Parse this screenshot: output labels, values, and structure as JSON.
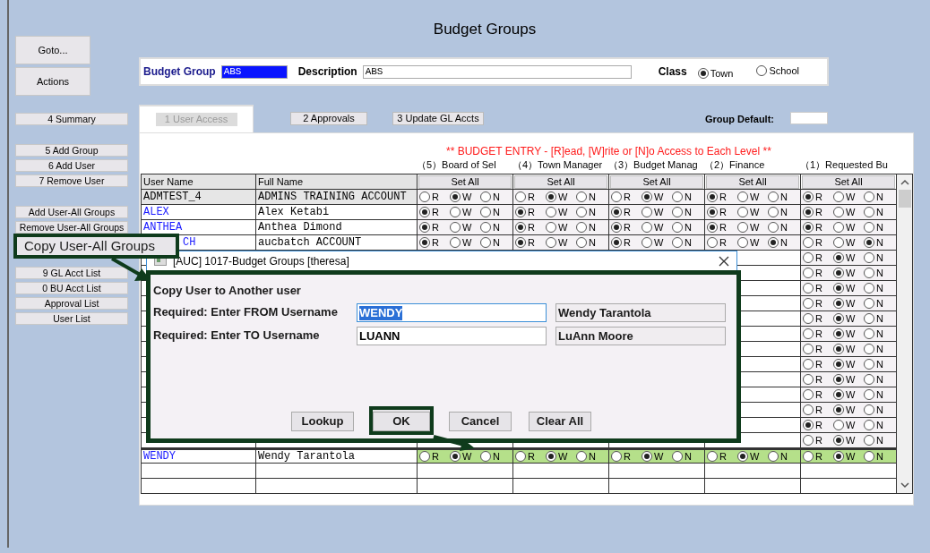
{
  "title": "Budget Groups",
  "sidebar": [
    [
      {
        "label": "Goto...",
        "kind": "large"
      },
      {
        "label": "Actions",
        "kind": "large"
      }
    ],
    [
      {
        "label": "4 Summary",
        "kind": "small"
      }
    ],
    [
      {
        "label": "5 Add Group",
        "kind": "small"
      },
      {
        "label": "6 Add User",
        "kind": "small"
      },
      {
        "label": "7 Remove User",
        "kind": "small"
      }
    ],
    [
      {
        "label": "Add User-All Groups",
        "kind": "small"
      },
      {
        "label": "Remove User-All Groups",
        "kind": "small"
      },
      {
        "kind": "covered"
      },
      {
        "kind": "covered"
      },
      {
        "label": "9 GL Acct List",
        "kind": "small"
      },
      {
        "label": "0 BU Acct List",
        "kind": "small"
      },
      {
        "label": "Approval List",
        "kind": "small"
      },
      {
        "label": "User List",
        "kind": "small"
      }
    ]
  ],
  "header": {
    "fields": [
      {
        "label": "Budget Group",
        "value": "ABS",
        "focused": true
      },
      {
        "label": "Description",
        "value": "ABS",
        "focused": false
      }
    ],
    "class": {
      "label": "Class",
      "options": [
        {
          "label": "Town",
          "selected": true
        },
        {
          "label": "School",
          "selected": false
        }
      ]
    }
  },
  "tabs": [
    {
      "label": "1 User Access",
      "selected": true
    },
    {
      "label": "2 Approvals",
      "selected": false
    },
    {
      "label": "3 Update GL Accts",
      "selected": false
    }
  ],
  "group_default": {
    "label": "Group Default:"
  },
  "table": {
    "notice": "** BUDGET ENTRY - [R]ead, [W]rite or [N]o Access to Each Level **",
    "level_columns": [
      {
        "heading": "（5）Board of Sel",
        "button": "Set All"
      },
      {
        "heading": "（4）Town Manager",
        "button": "Set All"
      },
      {
        "heading": "（3）Budget Manag",
        "button": "Set All"
      },
      {
        "heading": "（2）Finance",
        "button": "Set All"
      },
      {
        "heading": "（1）Requested Bu",
        "button": "Set All"
      }
    ],
    "columns": [
      "User Name",
      "Full Name"
    ],
    "rows": [
      {
        "user": "ADMTEST_4",
        "full_name": "ADMINS TRAINING ACCOUNT",
        "selected": true,
        "highlighted": false,
        "levels": [
          [
            {
              "label": "R",
              "selected": false
            },
            {
              "label": "W",
              "selected": true
            },
            {
              "label": "N",
              "selected": false
            }
          ],
          [
            {
              "label": "R",
              "selected": false
            },
            {
              "label": "W",
              "selected": true
            },
            {
              "label": "N",
              "selected": false
            }
          ],
          [
            {
              "label": "R",
              "selected": false
            },
            {
              "label": "W",
              "selected": true
            },
            {
              "label": "N",
              "selected": false
            }
          ],
          [
            {
              "label": "R",
              "selected": true
            },
            {
              "label": "W",
              "selected": false
            },
            {
              "label": "N",
              "selected": false
            }
          ],
          [
            {
              "label": "R",
              "selected": true
            },
            {
              "label": "W",
              "selected": false
            },
            {
              "label": "N",
              "selected": false
            }
          ]
        ]
      },
      {
        "user": "ALEX",
        "full_name": "Alex Ketabi",
        "selected": false,
        "highlighted": false,
        "levels": [
          [
            {
              "label": "R",
              "selected": true
            },
            {
              "label": "W",
              "selected": false
            },
            {
              "label": "N",
              "selected": false
            }
          ],
          [
            {
              "label": "R",
              "selected": true
            },
            {
              "label": "W",
              "selected": false
            },
            {
              "label": "N",
              "selected": false
            }
          ],
          [
            {
              "label": "R",
              "selected": true
            },
            {
              "label": "W",
              "selected": false
            },
            {
              "label": "N",
              "selected": false
            }
          ],
          [
            {
              "label": "R",
              "selected": true
            },
            {
              "label": "W",
              "selected": false
            },
            {
              "label": "N",
              "selected": false
            }
          ],
          [
            {
              "label": "R",
              "selected": true
            },
            {
              "label": "W",
              "selected": false
            },
            {
              "label": "N",
              "selected": false
            }
          ]
        ]
      },
      {
        "user": "ANTHEA",
        "full_name": "Anthea Dimond",
        "selected": false,
        "highlighted": false,
        "levels": [
          [
            {
              "label": "R",
              "selected": true
            },
            {
              "label": "W",
              "selected": false
            },
            {
              "label": "N",
              "selected": false
            }
          ],
          [
            {
              "label": "R",
              "selected": true
            },
            {
              "label": "W",
              "selected": false
            },
            {
              "label": "N",
              "selected": false
            }
          ],
          [
            {
              "label": "R",
              "selected": true
            },
            {
              "label": "W",
              "selected": false
            },
            {
              "label": "N",
              "selected": false
            }
          ],
          [
            {
              "label": "R",
              "selected": true
            },
            {
              "label": "W",
              "selected": false
            },
            {
              "label": "N",
              "selected": false
            }
          ],
          [
            {
              "label": "R",
              "selected": true
            },
            {
              "label": "W",
              "selected": false
            },
            {
              "label": "N",
              "selected": false
            }
          ]
        ]
      },
      {
        "user": "CH",
        "partly_covered": true,
        "full_name": "aucbatch ACCOUNT",
        "selected": false,
        "highlighted": false,
        "levels": [
          [
            {
              "label": "R",
              "selected": true
            },
            {
              "label": "W",
              "selected": false
            },
            {
              "label": "N",
              "selected": false
            }
          ],
          [
            {
              "label": "R",
              "selected": true
            },
            {
              "label": "W",
              "selected": false
            },
            {
              "label": "N",
              "selected": false
            }
          ],
          [
            {
              "label": "R",
              "selected": true
            },
            {
              "label": "W",
              "selected": false
            },
            {
              "label": "N",
              "selected": false
            }
          ],
          [
            {
              "label": "R",
              "selected": false
            },
            {
              "label": "W",
              "selected": false
            },
            {
              "label": "N",
              "selected": true
            }
          ],
          [
            {
              "label": "R",
              "selected": false
            },
            {
              "label": "W",
              "selected": false
            },
            {
              "label": "N",
              "selected": true
            }
          ]
        ]
      },
      {
        "selected": false,
        "highlighted": false,
        "levels": [
          [
            {
              "label": "R",
              "selected": false
            },
            {
              "label": "W",
              "selected": true
            },
            {
              "label": "N",
              "selected": false
            }
          ]
        ]
      },
      {
        "selected": false,
        "highlighted": false,
        "levels": [
          [
            {
              "label": "R",
              "selected": false
            },
            {
              "label": "W",
              "selected": true
            },
            {
              "label": "N",
              "selected": false
            }
          ]
        ]
      },
      {
        "selected": false,
        "highlighted": false,
        "levels": [
          [
            {
              "label": "R",
              "selected": false
            },
            {
              "label": "W",
              "selected": true
            },
            {
              "label": "N",
              "selected": false
            }
          ]
        ]
      },
      {
        "selected": false,
        "highlighted": false,
        "levels": [
          [
            {
              "label": "R",
              "selected": false
            },
            {
              "label": "W",
              "selected": true
            },
            {
              "label": "N",
              "selected": false
            }
          ]
        ]
      },
      {
        "selected": false,
        "highlighted": false,
        "levels": [
          [
            {
              "label": "R",
              "selected": false
            },
            {
              "label": "W",
              "selected": true
            },
            {
              "label": "N",
              "selected": false
            }
          ]
        ]
      },
      {
        "selected": false,
        "highlighted": false,
        "levels": [
          [
            {
              "label": "R",
              "selected": false
            },
            {
              "label": "W",
              "selected": true
            },
            {
              "label": "N",
              "selected": false
            }
          ]
        ]
      },
      {
        "selected": false,
        "highlighted": false,
        "levels": [
          [
            {
              "label": "R",
              "selected": false
            },
            {
              "label": "W",
              "selected": true
            },
            {
              "label": "N",
              "selected": false
            }
          ]
        ]
      },
      {
        "selected": false,
        "highlighted": false,
        "levels": [
          [
            {
              "label": "R",
              "selected": false
            },
            {
              "label": "W",
              "selected": true
            },
            {
              "label": "N",
              "selected": false
            }
          ]
        ]
      },
      {
        "selected": false,
        "highlighted": false,
        "levels": [
          [
            {
              "label": "R",
              "selected": false
            },
            {
              "label": "W",
              "selected": true
            },
            {
              "label": "N",
              "selected": false
            }
          ]
        ]
      },
      {
        "selected": false,
        "highlighted": false,
        "levels": [
          [
            {
              "label": "R",
              "selected": false
            },
            {
              "label": "W",
              "selected": true
            },
            {
              "label": "N",
              "selected": false
            }
          ]
        ]
      },
      {
        "selected": false,
        "highlighted": false,
        "levels": [
          [
            {
              "label": "R",
              "selected": false
            },
            {
              "label": "W",
              "selected": true
            },
            {
              "label": "N",
              "selected": false
            }
          ]
        ]
      },
      {
        "selected": false,
        "highlighted": false,
        "levels": [
          [
            {
              "label": "R",
              "selected": true
            },
            {
              "label": "W",
              "selected": false
            },
            {
              "label": "N",
              "selected": false
            }
          ]
        ]
      },
      {
        "selected": false,
        "highlighted": false,
        "levels": [
          [
            {
              "label": "R",
              "selected": false
            },
            {
              "label": "W",
              "selected": true
            },
            {
              "label": "N",
              "selected": false
            }
          ]
        ]
      },
      {
        "user": "WENDY",
        "full_name": "Wendy Tarantola",
        "selected": false,
        "highlighted": true,
        "levels": [
          [
            {
              "label": "R",
              "selected": false
            },
            {
              "label": "W",
              "selected": true
            },
            {
              "label": "N",
              "selected": false
            }
          ],
          [
            {
              "label": "R",
              "selected": false
            },
            {
              "label": "W",
              "selected": true
            },
            {
              "label": "N",
              "selected": false
            }
          ],
          [
            {
              "label": "R",
              "selected": false
            },
            {
              "label": "W",
              "selected": true
            },
            {
              "label": "N",
              "selected": false
            }
          ],
          [
            {
              "label": "R",
              "selected": false
            },
            {
              "label": "W",
              "selected": true
            },
            {
              "label": "N",
              "selected": false
            }
          ],
          [
            {
              "label": "R",
              "selected": false
            },
            {
              "label": "W",
              "selected": true
            },
            {
              "label": "N",
              "selected": false
            }
          ]
        ]
      }
    ]
  },
  "dialog": {
    "title": "[AUC] 1017-Budget Groups [theresa]",
    "heading": "Copy User to Another user",
    "fields": [
      {
        "label": "Required: Enter FROM Username",
        "value": "WENDY",
        "display": "Wendy Tarantola",
        "focused": true
      },
      {
        "label": "Required: Enter TO Username",
        "value": "LUANN",
        "display": "LuAnn Moore",
        "focused": false
      }
    ],
    "buttons": [
      {
        "label": "Lookup",
        "highlighted": false
      },
      {
        "label": "OK",
        "highlighted": true
      },
      {
        "label": "Cancel",
        "highlighted": false
      },
      {
        "label": "Clear All",
        "highlighted": false
      }
    ]
  },
  "callout": {
    "label": "Copy User-All Groups"
  }
}
